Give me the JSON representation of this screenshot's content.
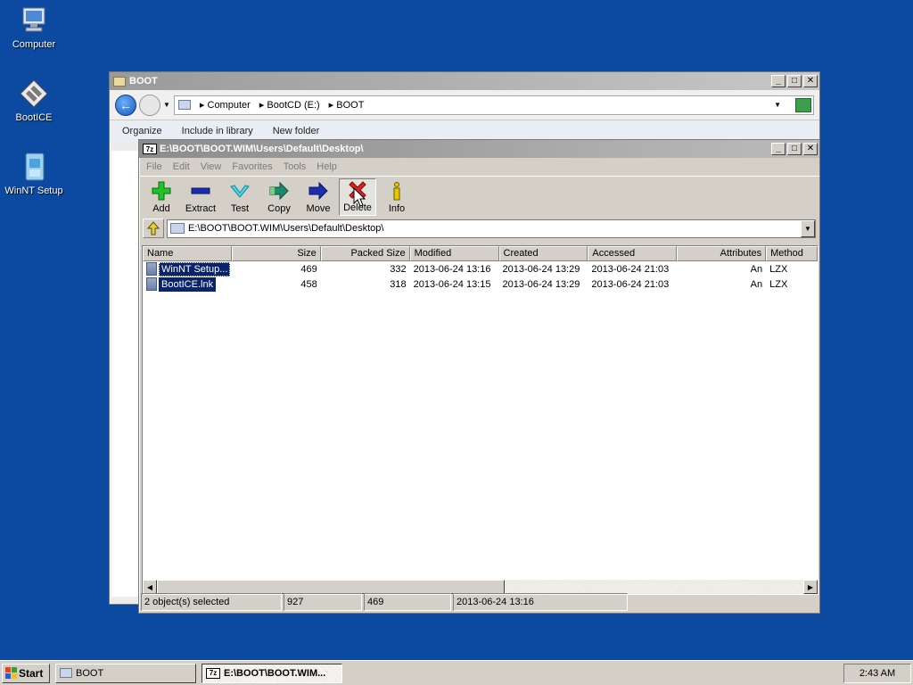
{
  "desktop": {
    "icons": [
      {
        "label": "Computer"
      },
      {
        "label": "BootICE"
      },
      {
        "label": "WinNT Setup"
      }
    ]
  },
  "explorer": {
    "title": "BOOT",
    "breadcrumbs": [
      "Computer",
      "BootCD (E:)",
      "BOOT"
    ],
    "commands": [
      "Organize",
      "Include in library",
      "New folder"
    ]
  },
  "zip": {
    "title": "E:\\BOOT\\BOOT.WIM\\Users\\Default\\Desktop\\",
    "menu": [
      "File",
      "Edit",
      "View",
      "Favorites",
      "Tools",
      "Help"
    ],
    "toolbar": [
      "Add",
      "Extract",
      "Test",
      "Copy",
      "Move",
      "Delete",
      "Info"
    ],
    "path": "E:\\BOOT\\BOOT.WIM\\Users\\Default\\Desktop\\",
    "columns": [
      "Name",
      "Size",
      "Packed Size",
      "Modified",
      "Created",
      "Accessed",
      "Attributes",
      "Method"
    ],
    "rows": [
      [
        "WinNT Setup...",
        "469",
        "332",
        "2013-06-24 13:16",
        "2013-06-24 13:29",
        "2013-06-24 21:03",
        "An",
        "LZX"
      ],
      [
        "BootICE.lnk",
        "458",
        "318",
        "2013-06-24 13:15",
        "2013-06-24 13:29",
        "2013-06-24 21:03",
        "An",
        "LZX"
      ]
    ],
    "status": {
      "selected": "2 object(s) selected",
      "total_size": "927",
      "sel_size": "469",
      "date": "2013-06-24 13:16"
    }
  },
  "taskbar": {
    "start": "Start",
    "tasks": [
      "BOOT",
      "E:\\BOOT\\BOOT.WIM..."
    ],
    "clock": "2:43 AM"
  },
  "icons": {
    "add": "plus-icon",
    "extract": "minus-icon",
    "test": "check-icon",
    "copy": "arrow-right-icon",
    "move": "arrow-right-icon",
    "delete": "x-icon",
    "info": "info-icon"
  },
  "colors": {
    "desktop": "#0b4aa0",
    "selection": "#0a246a"
  }
}
